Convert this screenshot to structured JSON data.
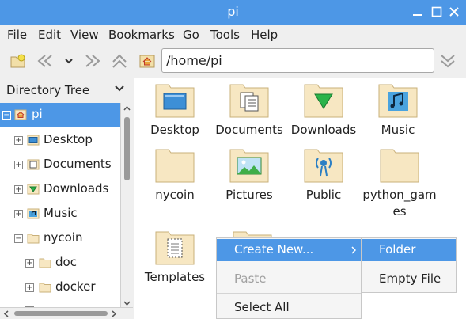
{
  "window": {
    "title": "pi"
  },
  "menubar": {
    "items": [
      "File",
      "Edit",
      "View",
      "Bookmarks",
      "Go",
      "Tools",
      "Help"
    ]
  },
  "toolbar": {
    "path": "/home/pi"
  },
  "sidebar": {
    "header": "Directory Tree",
    "tree": [
      {
        "label": "pi",
        "expander": "−",
        "icon": "home-folder-icon",
        "selected": true
      },
      {
        "label": "Desktop",
        "expander": "+",
        "icon": "desktop-folder-icon"
      },
      {
        "label": "Documents",
        "expander": "+",
        "icon": "documents-folder-icon"
      },
      {
        "label": "Downloads",
        "expander": "+",
        "icon": "downloads-folder-icon"
      },
      {
        "label": "Music",
        "expander": "+",
        "icon": "music-folder-icon"
      },
      {
        "label": "nycoin",
        "expander": "−",
        "icon": "folder-icon"
      },
      {
        "label": "doc",
        "expander": "+",
        "icon": "folder-icon"
      },
      {
        "label": "docker",
        "expander": "+",
        "icon": "folder-icon"
      }
    ]
  },
  "files": [
    {
      "label": "Desktop",
      "icon": "desktop"
    },
    {
      "label": "Documents",
      "icon": "documents"
    },
    {
      "label": "Downloads",
      "icon": "downloads"
    },
    {
      "label": "Music",
      "icon": "music"
    },
    {
      "label": "nycoin",
      "icon": "plain"
    },
    {
      "label": "Pictures",
      "icon": "pictures"
    },
    {
      "label": "Public",
      "icon": "public"
    },
    {
      "label": "python_games",
      "icon": "plain"
    },
    {
      "label": "Templates",
      "icon": "templates"
    }
  ],
  "context_menu": {
    "items": [
      {
        "label": "Create New...",
        "highlighted": true,
        "submenu": true
      },
      {
        "label": "Paste",
        "disabled": true
      },
      {
        "label": "Select All"
      }
    ],
    "submenu": [
      {
        "label": "Folder",
        "highlighted": true
      },
      {
        "label": "Empty File"
      }
    ]
  },
  "colors": {
    "accent": "#4d97e6",
    "folder": "#f7e7c2",
    "folder_border": "#c9b07a"
  }
}
